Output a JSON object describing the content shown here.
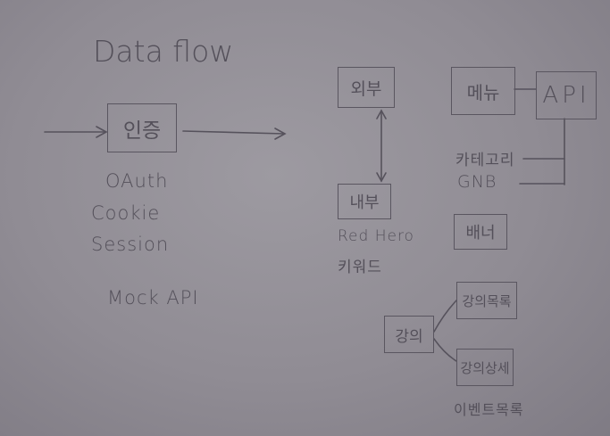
{
  "title": "Data flow",
  "nodes": {
    "auth": "인증",
    "external": "외부",
    "internal": "내부",
    "menu": "메뉴",
    "api": "API",
    "banner": "배너",
    "lecture": "강의",
    "lecture_list": "강의목록",
    "lecture_detail": "강의상세"
  },
  "auth_methods": [
    "OAuth",
    "Cookie",
    "Session"
  ],
  "mock_label": "Mock API",
  "internal_notes": [
    "Red Hero",
    "키워드"
  ],
  "menu_children": [
    "카테고리",
    "GNB"
  ],
  "lecture_footer": "이벤트목록",
  "colors": {
    "board": "#908c94",
    "ink": "#56525c"
  }
}
